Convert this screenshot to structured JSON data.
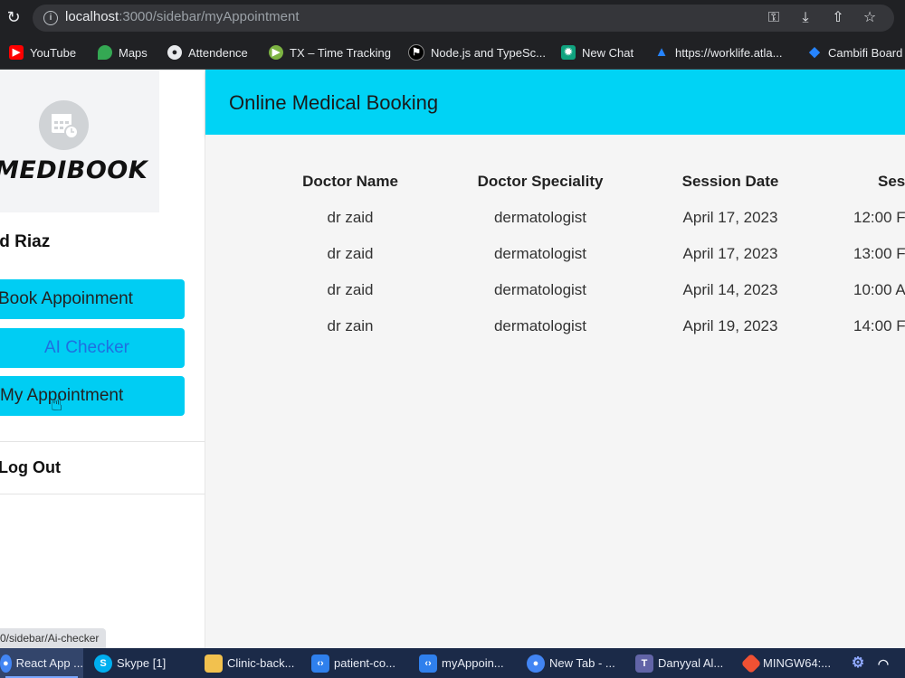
{
  "browser": {
    "url_host": "localhost",
    "url_path": ":3000/sidebar/myAppointment",
    "status_url": "0/sidebar/Ai-checker",
    "bookmarks": [
      {
        "label": "YouTube",
        "icon": "youtube-icon",
        "color": "#ff0000"
      },
      {
        "label": "Maps",
        "icon": "maps-pin-icon",
        "color": "#34a853"
      },
      {
        "label": "Attendence",
        "icon": "globe-icon",
        "color": "#5f6368"
      },
      {
        "label": "TX – Time Tracking",
        "icon": "play-circle-icon",
        "color": "#7cb342"
      },
      {
        "label": "Node.js and TypeSc...",
        "icon": "github-icon",
        "color": "#000000"
      },
      {
        "label": "New Chat",
        "icon": "chatgpt-icon",
        "color": "#10a37f"
      },
      {
        "label": "https://worklife.atla...",
        "icon": "atlassian-icon",
        "color": "#2684ff"
      },
      {
        "label": "Cambifi Board",
        "icon": "jira-icon",
        "color": "#2684ff"
      }
    ]
  },
  "sidebar": {
    "logo_text": "MEDIBOOK",
    "user_name": "id Riaz",
    "buttons": [
      {
        "label": "Book Appoinment"
      },
      {
        "label": "AI Checker"
      },
      {
        "label": "My Appointment"
      }
    ],
    "logout_label": "Log Out"
  },
  "header": {
    "title": "Online Medical Booking"
  },
  "table": {
    "columns": [
      "Doctor Name",
      "Doctor Speciality",
      "Session Date",
      "Ses"
    ],
    "rows": [
      [
        "dr zaid",
        "dermatologist",
        "April 17, 2023",
        "12:00 F"
      ],
      [
        "dr zaid",
        "dermatologist",
        "April 17, 2023",
        "13:00 F"
      ],
      [
        "dr zaid",
        "dermatologist",
        "April 14, 2023",
        "10:00 A"
      ],
      [
        "dr zain",
        "dermatologist",
        "April 19, 2023",
        "14:00 F"
      ]
    ]
  },
  "taskbar": [
    {
      "label": "React App ...",
      "icon": "chrome-icon",
      "color": "#4285f4"
    },
    {
      "label": "Skype [1]",
      "icon": "skype-icon",
      "color": "#00aff0"
    },
    {
      "label": "Clinic-back...",
      "icon": "folder-icon",
      "color": "#f2c14e"
    },
    {
      "label": "patient-co...",
      "icon": "vscode-icon",
      "color": "#2f80ed"
    },
    {
      "label": "myAppoin...",
      "icon": "vscode-icon",
      "color": "#2f80ed"
    },
    {
      "label": "New Tab - ...",
      "icon": "chrome-icon",
      "color": "#4285f4"
    },
    {
      "label": "Danyyal Al...",
      "icon": "teams-icon",
      "color": "#6264a7"
    },
    {
      "label": "MINGW64:...",
      "icon": "git-bash-icon",
      "color": "#f05133"
    }
  ],
  "colors": {
    "accent": "#00cdf3",
    "header": "#00d3f5",
    "taskbar": "#1b2a48"
  }
}
